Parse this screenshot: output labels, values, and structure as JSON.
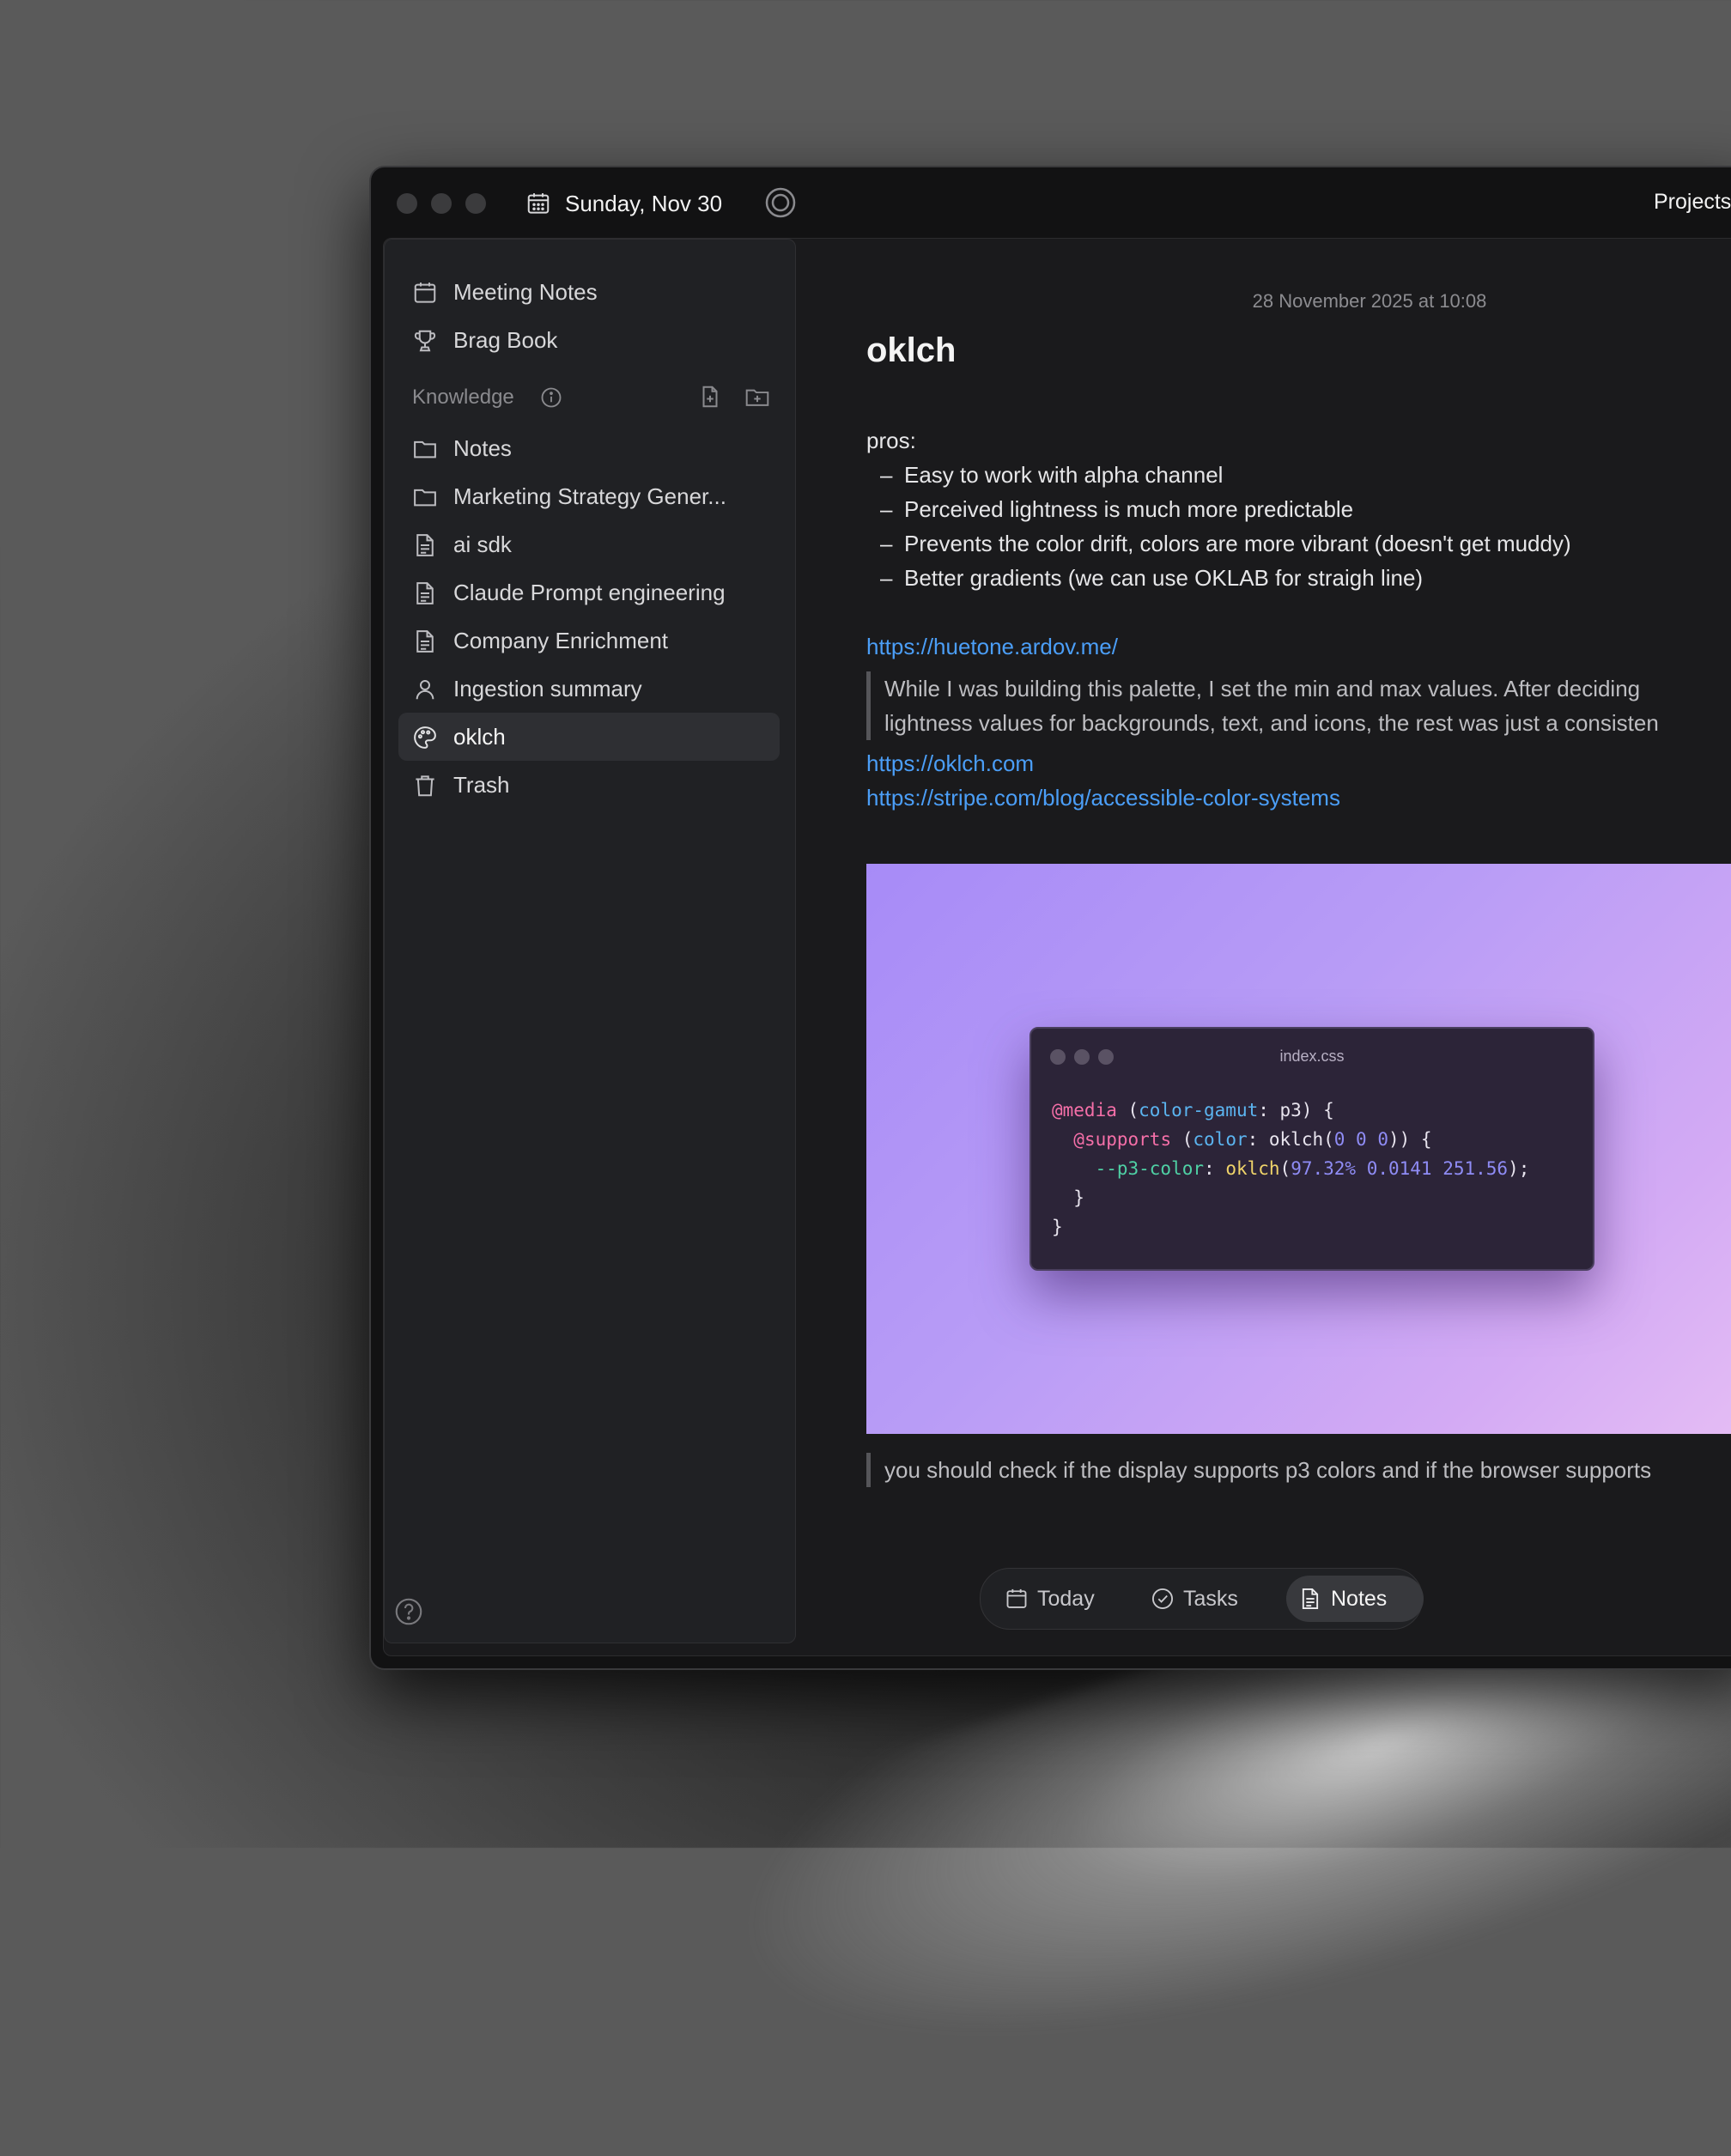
{
  "titlebar": {
    "date": "Sunday, Nov 30",
    "right_label": "Projects"
  },
  "sidebar": {
    "pinned": [
      {
        "label": "Meeting Notes",
        "icon": "calendar-icon"
      },
      {
        "label": "Brag Book",
        "icon": "trophy-icon"
      }
    ],
    "section_label": "Knowledge",
    "items": [
      {
        "label": "Notes",
        "icon": "folder-icon"
      },
      {
        "label": "Marketing Strategy Gener...",
        "icon": "folder-icon"
      },
      {
        "label": "ai sdk",
        "icon": "document-icon"
      },
      {
        "label": "Claude Prompt engineering",
        "icon": "document-icon"
      },
      {
        "label": "Company Enrichment",
        "icon": "document-icon"
      },
      {
        "label": "Ingestion summary",
        "icon": "person-icon"
      },
      {
        "label": "oklch",
        "icon": "palette-icon",
        "active": true
      },
      {
        "label": "Trash",
        "icon": "trash-icon"
      }
    ]
  },
  "note": {
    "timestamp": "28 November 2025 at 10:08",
    "title": "oklch",
    "pros_label": "pros:",
    "pros": [
      "Easy to work with alpha channel",
      "Perceived lightness is much more predictable",
      "Prevents the color drift, colors are more vibrant (doesn't get muddy)",
      "Better gradients (we can use OKLAB for straigh line)"
    ],
    "link1": "https://huetone.ardov.me/",
    "quote1_line1": "While I was building this palette, I set the min and max values.    After deciding",
    "quote1_line2": "lightness values for backgrounds, text, and icons, the rest was just a consisten",
    "link2": "https://oklch.com",
    "link3": "https://stripe.com/blog/accessible-color-systems",
    "image": {
      "filename": "index.css",
      "code": {
        "l1_at": "@media",
        "l1_prop": "color-gamut",
        "l1_rest": ": p3) {",
        "l2_at": "@supports",
        "l2_prop": "color",
        "l2_mid": ": oklch(",
        "l2_nums": "0 0 0",
        "l2_end": ")) {",
        "l3_var": "--p3-color",
        "l3_colon": ": ",
        "l3_fn": "oklch",
        "l3_nums": "97.32% 0.0141 251.56",
        "l3_end": ");",
        "l4": "}",
        "l5": "}"
      }
    },
    "quote2": "you should check if the display supports p3 colors and if the browser supports"
  },
  "toolbar": {
    "today": "Today",
    "tasks": "Tasks",
    "notes": "Notes"
  },
  "colors": {
    "link": "#4b9ef7",
    "background": "#1a1a1c",
    "sidebar": "#202124"
  }
}
